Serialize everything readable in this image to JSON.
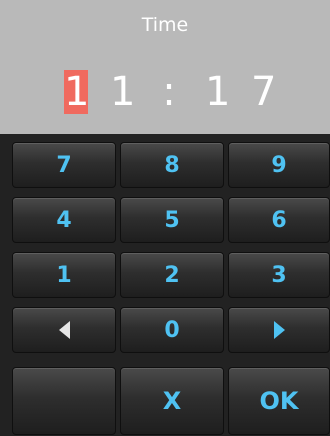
{
  "header": {
    "title": "Time"
  },
  "time": {
    "d1": "1",
    "d2": "1",
    "sep": ":",
    "d3": "1",
    "d4": "7"
  },
  "keypad": {
    "k7": "7",
    "k8": "8",
    "k9": "9",
    "k4": "4",
    "k5": "5",
    "k6": "6",
    "k1": "1",
    "k2": "2",
    "k3": "3",
    "k0": "0",
    "cancel": "X",
    "ok": "OK"
  },
  "colors": {
    "header_bg": "#b9b9b9",
    "selected_digit_bg": "#f06a5f",
    "key_text": "#4fc2f2"
  },
  "icons": {
    "left": "left-triangle-icon",
    "right": "right-triangle-icon"
  }
}
